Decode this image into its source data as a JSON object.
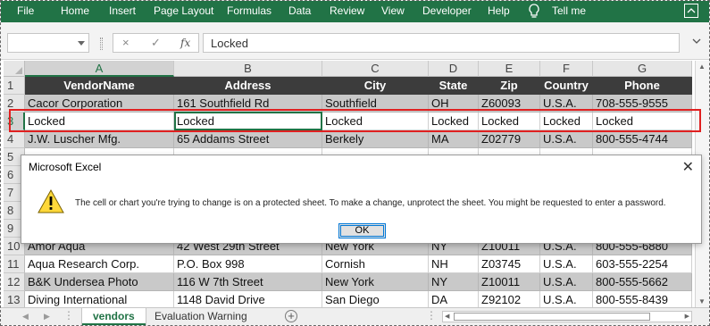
{
  "ribbon": {
    "tabs": [
      "File",
      "Home",
      "Insert",
      "Page Layout",
      "Formulas",
      "Data",
      "Review",
      "View",
      "Developer",
      "Help"
    ],
    "tell_me": "Tell me",
    "bg_color": "#217346"
  },
  "formula_bar": {
    "name_box": "",
    "cancel_icon": "×",
    "enter_icon": "✓",
    "fx": "fx",
    "value": "Locked"
  },
  "sheet": {
    "columns": [
      "A",
      "B",
      "C",
      "D",
      "E",
      "F",
      "G"
    ],
    "selected_column": "A",
    "header": [
      "VendorName",
      "Address",
      "City",
      "State",
      "Zip",
      "Country",
      "Phone"
    ],
    "rows": [
      {
        "num": "2",
        "cells": [
          "Cacor Corporation",
          "161 Southfield Rd",
          "Southfield",
          "OH",
          "Z60093",
          "U.S.A.",
          "708-555-9555"
        ]
      },
      {
        "num": "3",
        "cells": [
          "Locked",
          "Locked",
          "Locked",
          "Locked",
          "Locked",
          "Locked",
          "Locked"
        ]
      },
      {
        "num": "4",
        "cells": [
          "J.W.  Luscher Mfg.",
          "65 Addams Street",
          "Berkely",
          "MA",
          "Z02779",
          "U.S.A.",
          "800-555-4744"
        ]
      },
      {
        "num": "5",
        "cells": [
          "",
          "",
          "",
          "",
          "",
          "",
          ""
        ]
      },
      {
        "num": "6",
        "cells": [
          "",
          "",
          "",
          "",
          "",
          "",
          ""
        ]
      },
      {
        "num": "7",
        "cells": [
          "",
          "",
          "",
          "",
          "",
          "",
          ""
        ]
      },
      {
        "num": "8",
        "cells": [
          "",
          "",
          "",
          "",
          "",
          "",
          ""
        ]
      },
      {
        "num": "9",
        "cells": [
          "",
          "",
          "",
          "",
          "",
          "",
          ""
        ]
      },
      {
        "num": "10",
        "cells": [
          "Amor Aqua",
          "42 West 29th Street",
          "New York",
          "NY",
          "Z10011",
          "U.S.A.",
          "800-555-6880"
        ]
      },
      {
        "num": "11",
        "cells": [
          "Aqua Research Corp.",
          "P.O. Box 998",
          "Cornish",
          "NH",
          "Z03745",
          "U.S.A.",
          "603-555-2254"
        ]
      },
      {
        "num": "12",
        "cells": [
          "B&K Undersea Photo",
          "116 W 7th Street",
          "New York",
          "NY",
          "Z10011",
          "U.S.A.",
          "800-555-5662"
        ]
      },
      {
        "num": "13",
        "cells": [
          "Diving International",
          "1148 David Drive",
          "San Diego",
          "DA",
          "Z92102",
          "U.S.A.",
          "800-555-8439"
        ]
      }
    ],
    "header_row_num": "1"
  },
  "dialog": {
    "title": "Microsoft Excel",
    "close": "✕",
    "message": "The cell or chart you're trying to change is on a protected sheet. To make a change, unprotect the sheet. You might be requested to enter a password.",
    "ok_label": "OK"
  },
  "sheet_tabs": {
    "tabs": [
      "vendors",
      "Evaluation Warning"
    ],
    "active": "vendors",
    "add_icon": "+"
  },
  "colors": {
    "excel_green": "#217346",
    "header_row": "#3c3c3c",
    "band_gray": "#c9c9c9",
    "highlight_red": "#e02020"
  }
}
